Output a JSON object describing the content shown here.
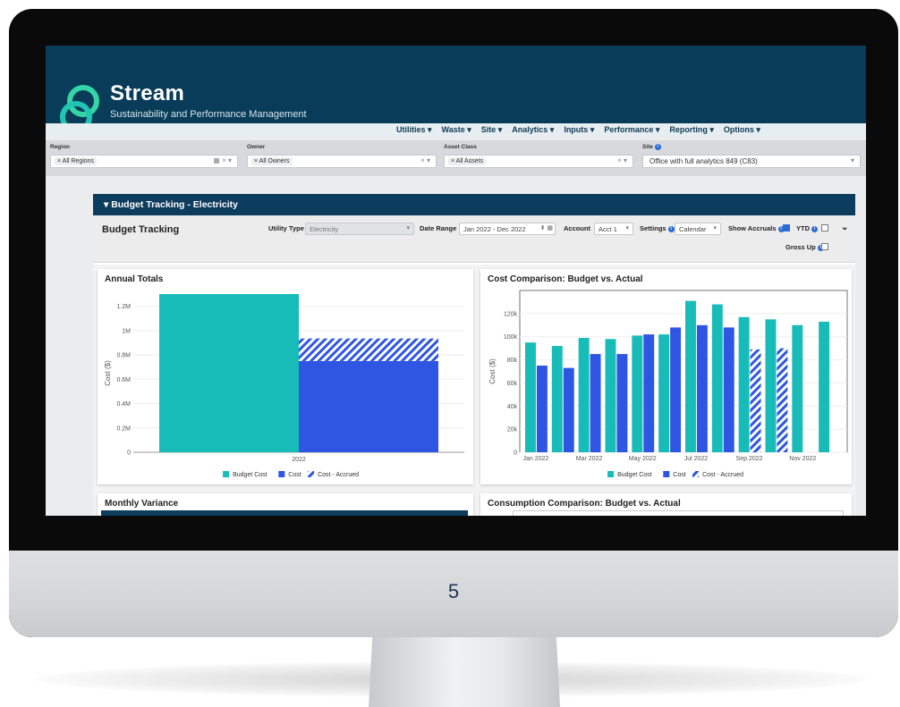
{
  "colors": {
    "teal": "#17bcb9",
    "blue": "#2f55e3",
    "nav": "#083c58",
    "section_head": "#0d3d5e"
  },
  "app": {
    "name": "Stream",
    "tagline": "Sustainability and Performance Management"
  },
  "nav": [
    "Utilities ▾",
    "Waste ▾",
    "Site ▾",
    "Analytics ▾",
    "Inputs ▾",
    "Performance ▾",
    "Reporting ▾",
    "Options ▾"
  ],
  "filters": {
    "region": {
      "label": "Region",
      "value": "× All Regions"
    },
    "owner": {
      "label": "Owner",
      "value": "× All Owners"
    },
    "asset_class": {
      "label": "Asset Class",
      "value": "× All Assets"
    },
    "site": {
      "label": "Site",
      "value": "Office with full analytics 849 (C83)"
    }
  },
  "section": {
    "title": "▾ Budget Tracking - Electricity"
  },
  "toolbar": {
    "title": "Budget Tracking",
    "utility_type_label": "Utility Type",
    "utility_type_value": "Electricity",
    "date_range_label": "Date Range",
    "date_range_value": "Jan 2022 - Dec 2022",
    "account_label": "Account",
    "account_value": "Acct 1",
    "settings_label": "Settings",
    "settings_value": "Calendar",
    "show_accruals_label": "Show Accruals",
    "ytd_label": "YTD",
    "gross_up_label": "Gross Up"
  },
  "cards": {
    "annual_totals_title": "Annual Totals",
    "cost_comparison_title": "Cost Comparison: Budget vs. Actual",
    "monthly_variance_title": "Monthly Variance",
    "consumption_comparison_title": "Consumption Comparison: Budget vs. Actual"
  },
  "chart_data": [
    {
      "type": "bar",
      "title": "Annual Totals",
      "ylabel": "Cost ($)",
      "categories": [
        "2022"
      ],
      "ylim": [
        0,
        1300000
      ],
      "yticks": [
        0,
        200000,
        400000,
        600000,
        800000,
        1000000,
        1200000
      ],
      "ytick_labels": [
        "0",
        "0.2M",
        "0.4M",
        "0.6M",
        "0.8M",
        "1M",
        "1.2M"
      ],
      "series": [
        {
          "name": "Budget Cost",
          "values": [
            1300000
          ]
        },
        {
          "name": "Cost",
          "values": [
            750000
          ]
        },
        {
          "name": "Cost - Accrued",
          "values": [
            185000
          ],
          "stacked_on": "Cost"
        }
      ],
      "legend": "bottom"
    },
    {
      "type": "bar",
      "title": "Cost Comparison: Budget vs. Actual",
      "ylabel": "Cost ($)",
      "categories": [
        "Jan 2022",
        "Feb 2022",
        "Mar 2022",
        "Apr 2022",
        "May 2022",
        "Jun 2022",
        "Jul 2022",
        "Aug 2022",
        "Sep 2022",
        "Oct 2022",
        "Nov 2022",
        "Dec 2022"
      ],
      "xtick_labels": [
        "Jan 2022",
        "Mar 2022",
        "May 2022",
        "Jul 2022",
        "Sep 2022",
        "Nov 2022"
      ],
      "ylim": [
        0,
        140000
      ],
      "yticks": [
        0,
        20000,
        40000,
        60000,
        80000,
        100000,
        120000
      ],
      "ytick_labels": [
        "0",
        "20k",
        "40k",
        "60k",
        "80k",
        "100k",
        "120k"
      ],
      "series": [
        {
          "name": "Budget Cost",
          "values": [
            95000,
            92000,
            99000,
            98000,
            101000,
            102000,
            131000,
            128000,
            117000,
            115000,
            110000,
            113000
          ]
        },
        {
          "name": "Cost",
          "values": [
            75000,
            73000,
            85000,
            85000,
            102000,
            108000,
            110000,
            108000,
            null,
            null,
            null,
            null
          ]
        },
        {
          "name": "Cost - Accrued",
          "values": [
            null,
            null,
            null,
            null,
            null,
            null,
            null,
            null,
            89000,
            90000,
            null,
            null
          ]
        }
      ],
      "legend": "bottom"
    }
  ]
}
